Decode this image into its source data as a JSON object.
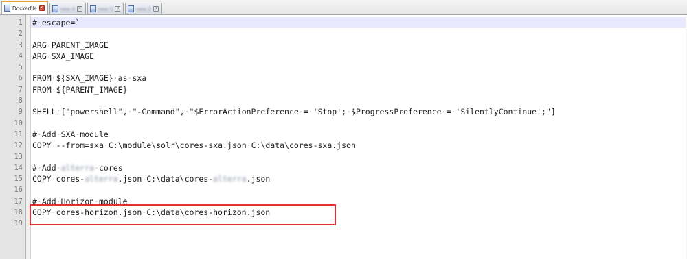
{
  "tabs": [
    {
      "label": "Dockerfile",
      "active": true,
      "blurred": false
    },
    {
      "label": "new 4",
      "active": false,
      "blurred": true
    },
    {
      "label": "new 5",
      "active": false,
      "blurred": true
    },
    {
      "label": "new 2",
      "active": false,
      "blurred": true
    }
  ],
  "editor": {
    "line_numbers": [
      "1",
      "2",
      "3",
      "4",
      "5",
      "6",
      "7",
      "8",
      "9",
      "10",
      "11",
      "12",
      "13",
      "14",
      "15",
      "16",
      "17",
      "18",
      "19"
    ],
    "lines": [
      "# escape=`",
      "",
      "ARG PARENT_IMAGE",
      "ARG SXA_IMAGE",
      "",
      "FROM ${SXA_IMAGE} as sxa",
      "FROM ${PARENT_IMAGE}",
      "",
      "SHELL [\"powershell\", \"-Command\", \"$ErrorActionPreference = 'Stop'; $ProgressPreference = 'SilentlyContinue';\"]",
      "",
      "# Add SXA module",
      "COPY --from=sxa C:\\module\\solr\\cores-sxa.json C:\\data\\cores-sxa.json",
      "",
      "# Add {{B}} cores",
      "COPY cores-{{B}}.json C:\\data\\cores-{{B}}.json",
      "",
      "# Add Horizon module",
      "COPY cores-horizon.json C:\\data\\cores-horizon.json",
      ""
    ],
    "blurred_word": "alterra",
    "current_line": 1,
    "highlighted_lines": [
      18
    ],
    "highlight_color": "#e03030",
    "current_line_color": "#e8e8ff"
  },
  "icons": {
    "tab_file": "file-icon",
    "tab_close": "close-icon"
  }
}
